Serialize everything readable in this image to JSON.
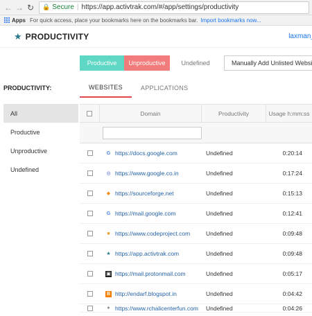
{
  "browser": {
    "secure_label": "Secure",
    "url": "https://app.activtrak.com/#/app/settings/productivity",
    "bookmarks": {
      "apps_label": "Apps",
      "info_text": "For quick access, place your bookmarks here on the bookmarks bar.",
      "import_link": "Import bookmarks now..."
    }
  },
  "header": {
    "title": "PRODUCTIVITY",
    "user": "laxman_"
  },
  "filters": {
    "productive": "Productive",
    "unproductive": "Unproductive",
    "undefined": "Undefined",
    "manual_add": "Manually Add Unlisted Website"
  },
  "section_label": "PRODUCTIVITY:",
  "tabs": [
    "WEBSITES",
    "APPLICATIONS"
  ],
  "sidebar": [
    "All",
    "Productive",
    "Unproductive",
    "Undefined"
  ],
  "table": {
    "columns": [
      "Domain",
      "Productivity",
      "Usage h:mm:ss"
    ],
    "rows": [
      {
        "domain": "https://docs.google.com",
        "productivity": "Undefined",
        "usage": "0:20:14",
        "icon": "google-icon"
      },
      {
        "domain": "https://www.google.co.in",
        "productivity": "Undefined",
        "usage": "0:17:24",
        "icon": "globe-icon"
      },
      {
        "domain": "https://sourceforge.net",
        "productivity": "Undefined",
        "usage": "0:15:13",
        "icon": "sourceforge-icon"
      },
      {
        "domain": "https://mail.google.com",
        "productivity": "Undefined",
        "usage": "0:12:41",
        "icon": "google-icon"
      },
      {
        "domain": "https://www.codeproject.com",
        "productivity": "Undefined",
        "usage": "0:09:48",
        "icon": "codeproject-icon"
      },
      {
        "domain": "https://app.activtrak.com",
        "productivity": "Undefined",
        "usage": "0:09:48",
        "icon": "activtrak-icon"
      },
      {
        "domain": "https://mail.protonmail.com",
        "productivity": "Undefined",
        "usage": "0:05:17",
        "icon": "protonmail-icon"
      },
      {
        "domain": "http://endarf.blogspot.in",
        "productivity": "Undefined",
        "usage": "0:04:42",
        "icon": "blogger-icon"
      },
      {
        "domain": "https://www.rchalicenterfun.com",
        "productivity": "Undefined",
        "usage": "0:04:26",
        "icon": "site-icon"
      }
    ]
  },
  "colors": {
    "productive": "#5ed7c4",
    "unproductive": "#f27b7b",
    "active_tab": "#e0474c",
    "link": "#2563a6"
  }
}
